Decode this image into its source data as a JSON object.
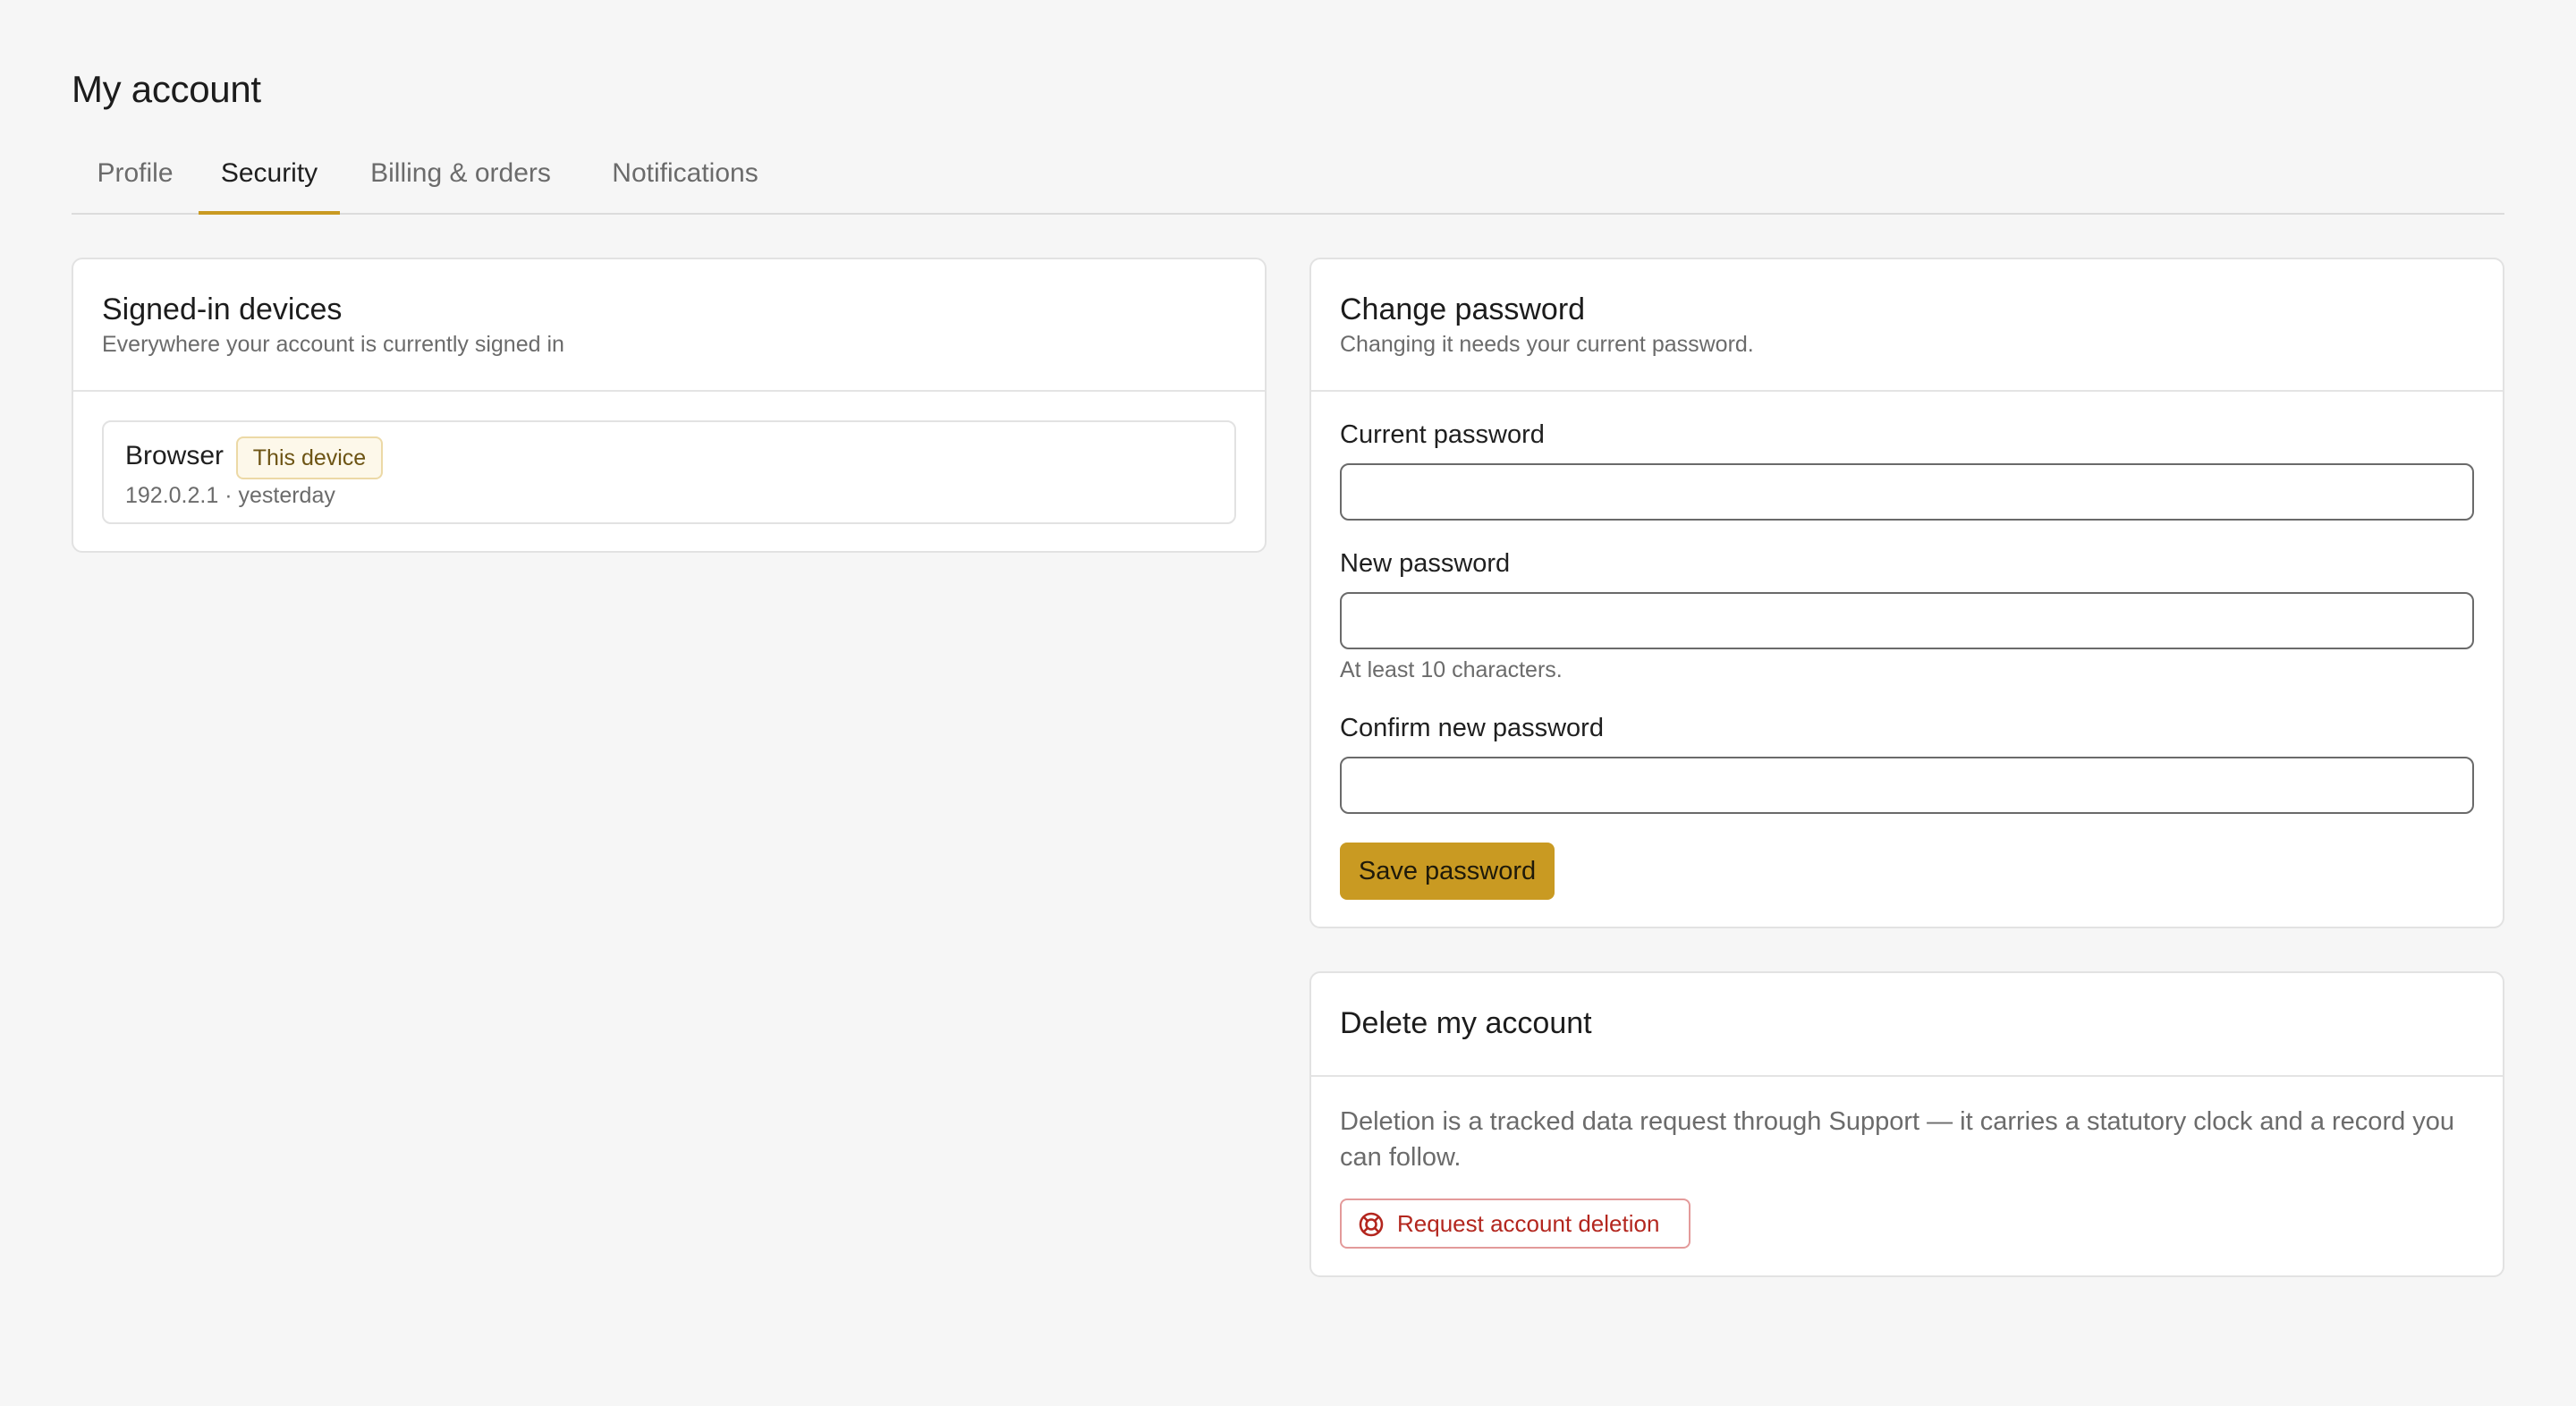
{
  "page": {
    "title": "My account"
  },
  "tabs": [
    {
      "label": "Profile",
      "active": false
    },
    {
      "label": "Security",
      "active": true
    },
    {
      "label": "Billing & orders",
      "active": false
    },
    {
      "label": "Notifications",
      "active": false
    }
  ],
  "devices": {
    "title": "Signed-in devices",
    "subtitle": "Everywhere your account is currently signed in",
    "items": [
      {
        "name": "Browser",
        "badge": "This device",
        "meta": "192.0.2.1 · yesterday"
      }
    ]
  },
  "password": {
    "title": "Change password",
    "subtitle": "Changing it needs your current password.",
    "current_label": "Current password",
    "current_value": "",
    "new_label": "New password",
    "new_value": "",
    "new_hint": "At least 10 characters.",
    "confirm_label": "Confirm new password",
    "confirm_value": "",
    "save_label": "Save password"
  },
  "delete": {
    "title": "Delete my account",
    "text": "Deletion is a tracked data request through Support — it carries a statutory clock and a record you can follow.",
    "button_label": "Request account deletion",
    "button_icon": "lifebuoy-icon"
  },
  "colors": {
    "accent": "#c99a22",
    "danger": "#b3261e",
    "background": "#f6f6f6"
  }
}
